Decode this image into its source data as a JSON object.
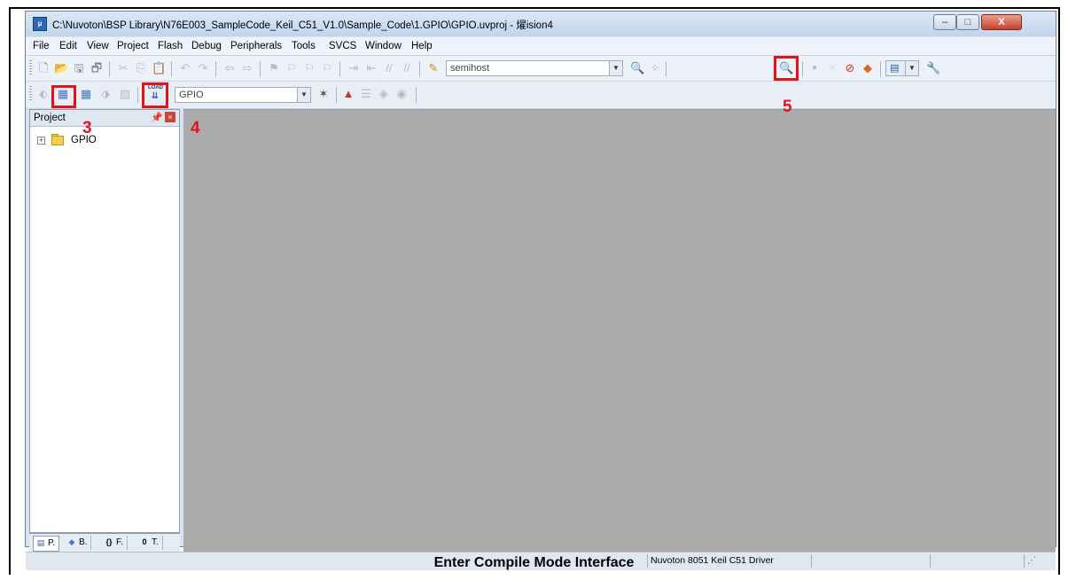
{
  "window": {
    "title": "C:\\Nuvoton\\BSP Library\\N76E003_SampleCode_Keil_C51_V1.0\\Sample_Code\\1.GPIO\\GPIO.uvproj - 燿ision4",
    "min_glyph": "–",
    "max_glyph": "□",
    "close_glyph": "X"
  },
  "menu": [
    "File",
    "Edit",
    "View",
    "Project",
    "Flash",
    "Debug",
    "Peripherals",
    "Tools",
    "SVCS",
    "Window",
    "Help"
  ],
  "toolbar1": {
    "find_combo_value": "semihost",
    "icons": [
      "new-file-icon",
      "open-file-icon",
      "save-icon",
      "save-all-icon",
      "cut-icon",
      "copy-icon",
      "paste-icon",
      "undo-icon",
      "redo-icon",
      "nav-back-icon",
      "nav-forward-icon",
      "bookmark-icon",
      "prev-bookmark-icon",
      "next-bookmark-icon",
      "clear-bookmarks-icon",
      "indent-icon",
      "unindent-icon",
      "comment-icon",
      "uncomment-icon",
      "find-in-files-icon",
      "debug-session-icon",
      "breakpoint-icon",
      "breakpoint-disable-icon",
      "kill-breakpoints-icon",
      "window-icon",
      "configure-icon"
    ]
  },
  "toolbar2": {
    "target_combo_value": "GPIO",
    "load_label": "LOAD"
  },
  "callouts": {
    "c3": "3",
    "c4": "4",
    "c5": "5"
  },
  "project_pane": {
    "title": "Project",
    "tree_root": "GPIO",
    "tabs": [
      "P.",
      "B.",
      "F.",
      "T."
    ]
  },
  "status": {
    "driver": "Nuvoton 8051 Keil C51 Driver"
  },
  "caption": "Enter Compile Mode Interface",
  "colors": {
    "highlight": "#e1141b",
    "editor_bg": "#ababab"
  }
}
